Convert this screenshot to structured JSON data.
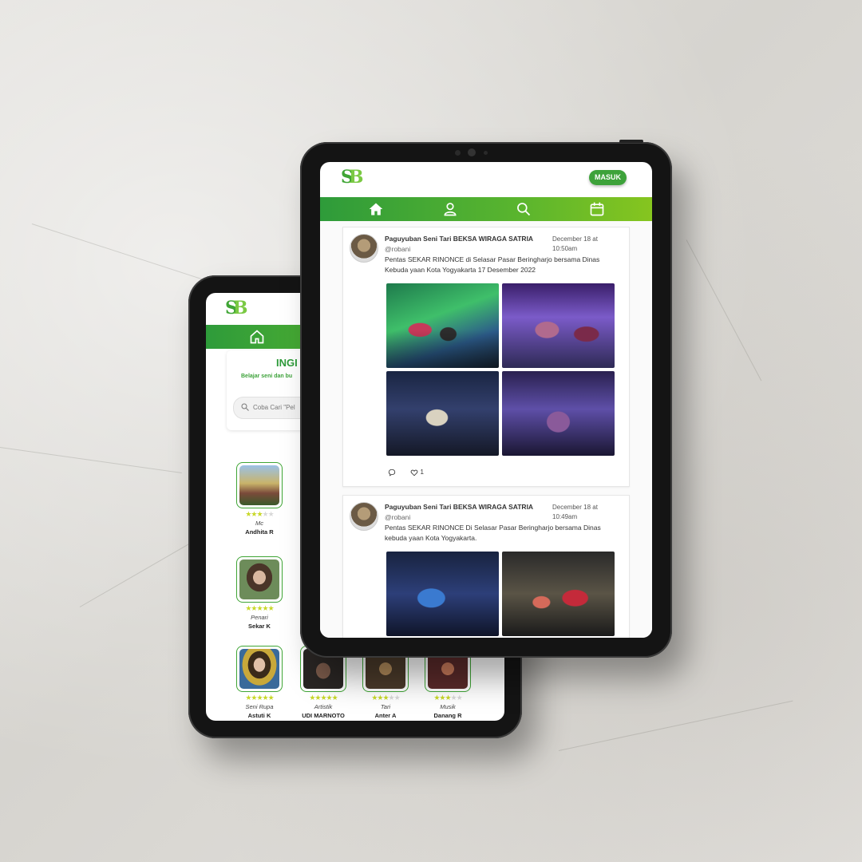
{
  "front": {
    "login_label": "MASUK",
    "nav": [
      "home-icon",
      "user-icon",
      "search-icon",
      "calendar-icon"
    ],
    "posts": [
      {
        "author": "Paguyuban Seni Tari BEKSA WIRAGA SATRIA",
        "handle": "@robani",
        "date": "December 18 at 10:50am",
        "text": "Pentas SEKAR RINONCE di Selasar Pasar Beringharjo bersama Dinas Kebuda yaan Kota Yogyakarta 17 Desember 2022",
        "comments_icon": "comment-icon",
        "likes": "1"
      },
      {
        "author": "Paguyuban Seni Tari BEKSA WIRAGA SATRIA",
        "handle": "@robani",
        "date": "December 18 at 10:49am",
        "text": "Pentas SEKAR RINONCE Di Selasar Pasar Beringharjo bersama Dinas kebuda yaan Kota Yogyakarta."
      }
    ]
  },
  "back": {
    "heading": "INGI",
    "subheading": "Belajar seni dan bu",
    "search_placeholder": "Coba Cari \"Pel",
    "artists": [
      {
        "role": "Mc",
        "name": "Andhita R",
        "rating": 3
      },
      {
        "role": "Penari",
        "name": "Sekar K",
        "rating": 5
      },
      {
        "role": "Seni Rupa",
        "name": "Astuti K",
        "rating": 5
      },
      {
        "role": "Artistik",
        "name": "UDI MARNOTO",
        "rating": 5
      },
      {
        "role": "Tari",
        "name": "Anter A",
        "rating": 3
      },
      {
        "role": "Musik",
        "name": "Danang R",
        "rating": 3
      }
    ]
  },
  "colors": {
    "brand_green": "#3da23a",
    "nav_green_end": "#86c51f",
    "star": "#c8d82a"
  }
}
